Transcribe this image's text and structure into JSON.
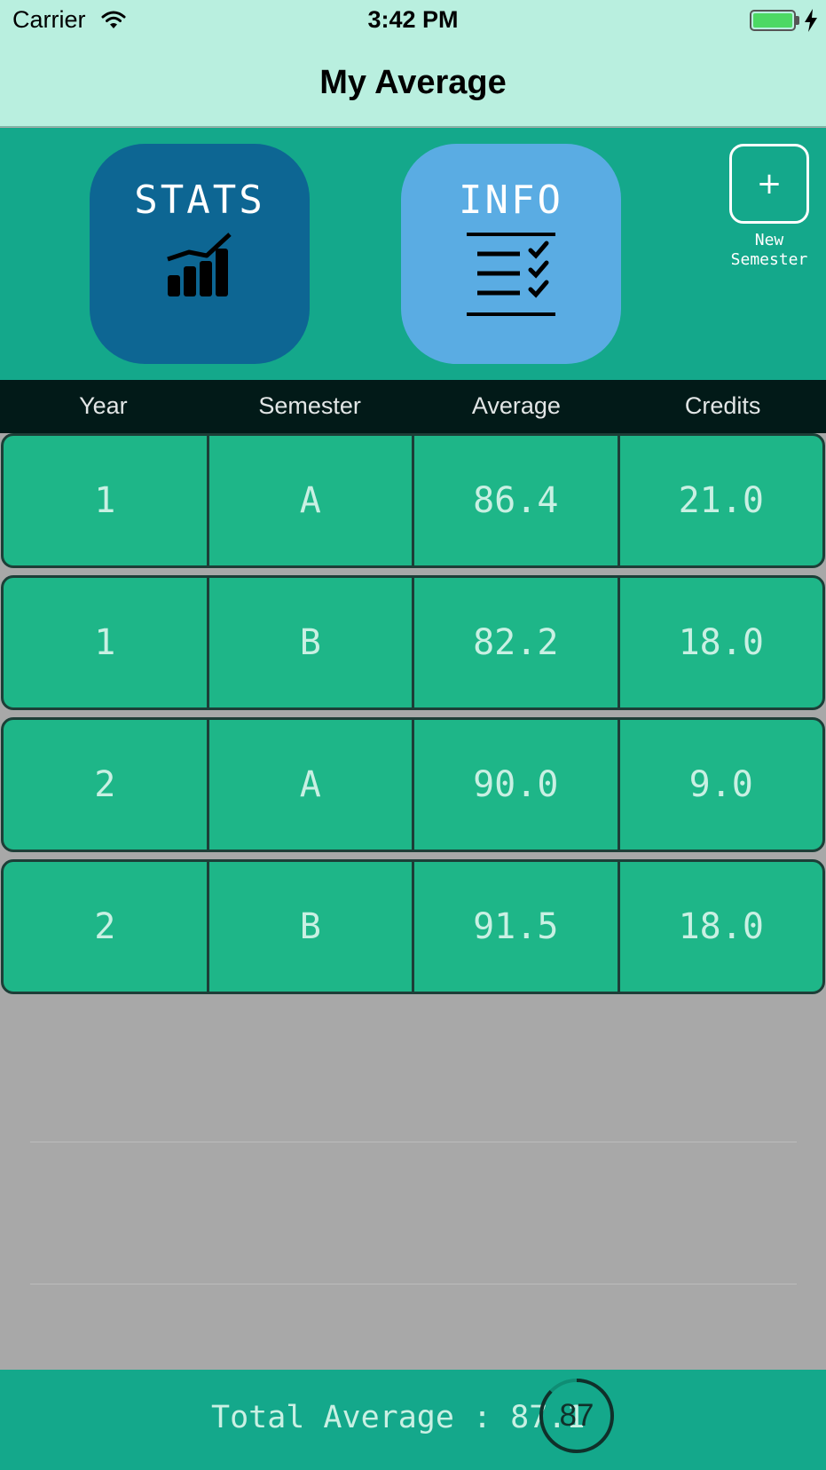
{
  "status_bar": {
    "carrier": "Carrier",
    "time": "3:42 PM",
    "battery_color": "#4cd964"
  },
  "nav": {
    "title": "My Average"
  },
  "tiles": {
    "stats": {
      "label": "STATS",
      "icon": "bar-chart-trend-icon",
      "color": "#0d6693"
    },
    "info": {
      "label": "INFO",
      "icon": "checklist-icon",
      "color": "#5aace3"
    }
  },
  "new_semester": {
    "symbol": "+",
    "label": "New\nSemester"
  },
  "table": {
    "headers": [
      "Year",
      "Semester",
      "Average",
      "Credits"
    ],
    "rows": [
      [
        "1",
        "A",
        "86.4",
        "21.0"
      ],
      [
        "1",
        "B",
        "82.2",
        "18.0"
      ],
      [
        "2",
        "A",
        "90.0",
        "9.0"
      ],
      [
        "2",
        "B",
        "91.5",
        "18.0"
      ]
    ]
  },
  "footer": {
    "total_label": "Total Average : 87.1",
    "gauge_value": "87",
    "gauge_fraction": 0.87
  },
  "colors": {
    "accent": "#14a88b",
    "row": "#1eb688",
    "header": "#021a18"
  }
}
